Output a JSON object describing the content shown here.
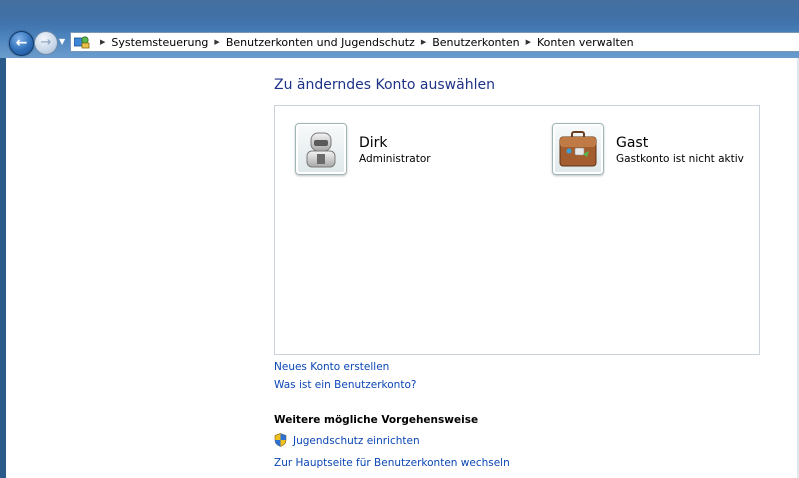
{
  "breadcrumb": {
    "items": [
      {
        "label": "Systemsteuerung"
      },
      {
        "label": "Benutzerkonten und Jugendschutz"
      },
      {
        "label": "Benutzerkonten"
      },
      {
        "label": "Konten verwalten"
      }
    ]
  },
  "main": {
    "title": "Zu änderndes Konto auswählen",
    "accounts": [
      {
        "name": "Dirk",
        "role": "Administrator",
        "icon": "robot-user-icon"
      },
      {
        "name": "Gast",
        "role": "Gastkonto ist nicht aktiv",
        "icon": "suitcase-icon"
      }
    ],
    "links": {
      "new_account": "Neues Konto erstellen",
      "what_is": "Was ist ein Benutzerkonto?"
    },
    "more_actions": {
      "heading": "Weitere mögliche Vorgehensweise",
      "parental": "Jugendschutz einrichten",
      "home": "Zur Hauptseite für Benutzerkonten wechseln"
    }
  },
  "colors": {
    "title_blue": "#1e3287",
    "link_blue": "#0a46b4",
    "chrome_blue": "#3b6ea6"
  }
}
